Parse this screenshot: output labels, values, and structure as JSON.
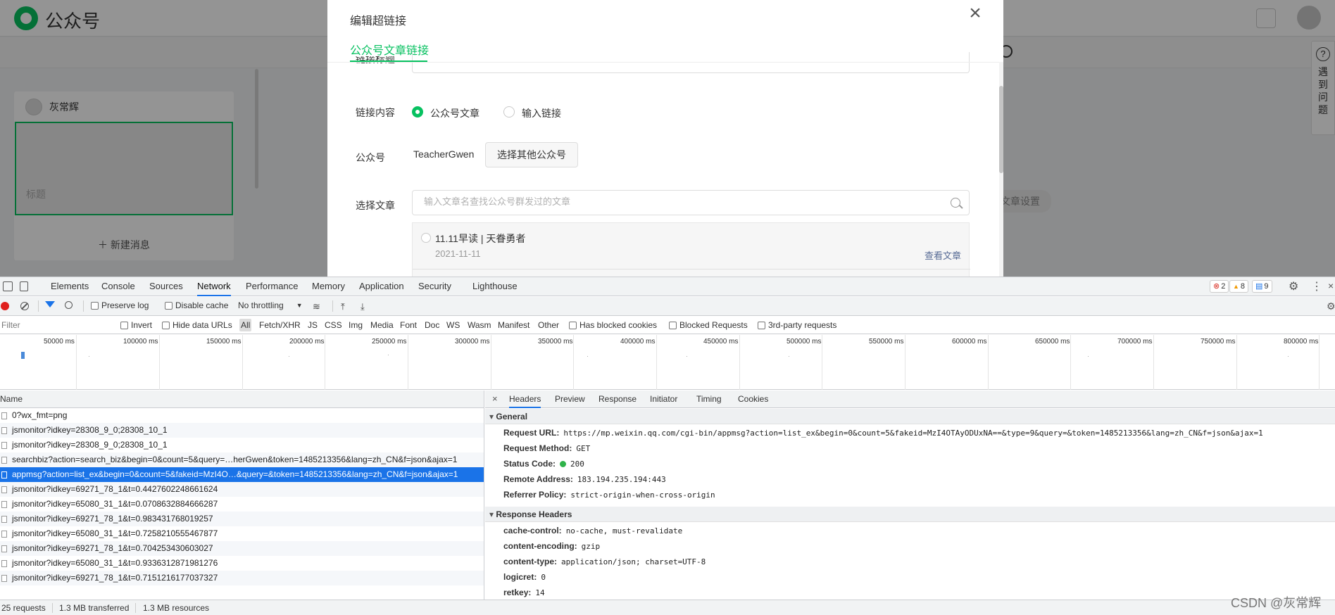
{
  "app": {
    "logo_text": "公众号",
    "author": "灰常辉",
    "cover_title_placeholder": "标题",
    "new_message": "＋ 新建消息",
    "article_settings": "文章设置",
    "help_icon": "?",
    "help_text": "遇到问题"
  },
  "modal": {
    "title": "编辑超链接",
    "close_icon": "×",
    "tab": "公众号文章链接",
    "link_title_label": "链接标题",
    "content_label": "链接内容",
    "option_article": "公众号文章",
    "option_input": "输入链接",
    "account_label": "公众号",
    "account_name": "TeacherGwen",
    "choose_other": "选择其他公众号",
    "choose_article_label": "选择文章",
    "search_placeholder": "输入文章名查找公众号群发过的文章",
    "article": {
      "title": "11.11早读 | 天眷勇者",
      "date": "2021-11-11",
      "view": "查看文章"
    }
  },
  "devtools": {
    "tabs": [
      "Elements",
      "Console",
      "Sources",
      "Network",
      "Performance",
      "Memory",
      "Application",
      "Security",
      "Lighthouse"
    ],
    "active_tab": "Network",
    "badges": {
      "errors": "2",
      "warnings": "8",
      "messages": "9"
    },
    "toolbar": {
      "preserve_log": "Preserve log",
      "disable_cache": "Disable cache",
      "throttling": "No throttling"
    },
    "filterbar": {
      "filter_placeholder": "Filter",
      "invert": "Invert",
      "hide_data_urls": "Hide data URLs",
      "types": [
        "All",
        "Fetch/XHR",
        "JS",
        "CSS",
        "Img",
        "Media",
        "Font",
        "Doc",
        "WS",
        "Wasm",
        "Manifest",
        "Other"
      ],
      "has_blocked_cookies": "Has blocked cookies",
      "blocked_requests": "Blocked Requests",
      "third_party": "3rd-party requests"
    },
    "overview_ticks": [
      "50000 ms",
      "100000 ms",
      "150000 ms",
      "200000 ms",
      "250000 ms",
      "300000 ms",
      "350000 ms",
      "400000 ms",
      "450000 ms",
      "500000 ms",
      "550000 ms",
      "600000 ms",
      "650000 ms",
      "700000 ms",
      "750000 ms",
      "800000 ms"
    ],
    "requests_header": "Name",
    "requests": [
      "0?wx_fmt=png",
      "jsmonitor?idkey=28308_9_0;28308_10_1",
      "jsmonitor?idkey=28308_9_0;28308_10_1",
      "searchbiz?action=search_biz&begin=0&count=5&query=…herGwen&token=1485213356&lang=zh_CN&f=json&ajax=1",
      "appmsg?action=list_ex&begin=0&count=5&fakeid=MzI4O…&query=&token=1485213356&lang=zh_CN&f=json&ajax=1",
      "jsmonitor?idkey=69271_78_1&t=0.4427602248661624",
      "jsmonitor?idkey=65080_31_1&t=0.0708632884666287",
      "jsmonitor?idkey=69271_78_1&t=0.983431768019257",
      "jsmonitor?idkey=65080_31_1&t=0.7258210555467877",
      "jsmonitor?idkey=69271_78_1&t=0.704253430603027",
      "jsmonitor?idkey=65080_31_1&t=0.9336312871981276",
      "jsmonitor?idkey=69271_78_1&t=0.7151216177037327"
    ],
    "detail_close": "×",
    "detail_tabs": [
      "Headers",
      "Preview",
      "Response",
      "Initiator",
      "Timing",
      "Cookies"
    ],
    "general": {
      "heading": "General",
      "request_url_k": "Request URL:",
      "request_url_v": "https://mp.weixin.qq.com/cgi-bin/appmsg?action=list_ex&begin=0&count=5&fakeid=MzI4OTAyODUxNA==&type=9&query=&token=1485213356&lang=zh_CN&f=json&ajax=1",
      "method_k": "Request Method:",
      "method_v": "GET",
      "status_k": "Status Code:",
      "status_v": "200",
      "remote_k": "Remote Address:",
      "remote_v": "183.194.235.194:443",
      "referrer_k": "Referrer Policy:",
      "referrer_v": "strict-origin-when-cross-origin"
    },
    "response_headers": {
      "heading": "Response Headers",
      "cache_k": "cache-control:",
      "cache_v": "no-cache, must-revalidate",
      "encoding_k": "content-encoding:",
      "encoding_v": "gzip",
      "type_k": "content-type:",
      "type_v": "application/json; charset=UTF-8",
      "logicret_k": "logicret:",
      "logicret_v": "0",
      "retkey_k": "retkey:",
      "retkey_v": "14"
    },
    "status": {
      "requests": "25 requests",
      "transferred": "1.3 MB transferred",
      "resources": "1.3 MB resources"
    }
  },
  "watermark": "CSDN @灰常辉"
}
